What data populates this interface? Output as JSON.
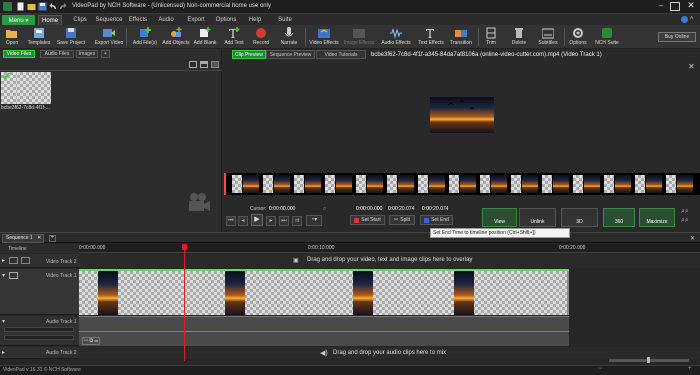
{
  "window": {
    "title": "VideoPad by NCH Software - (Unlicensed) Non-commercial home use only",
    "status": "VideoPad v 16.31 © NCH Software"
  },
  "menu": {
    "menu_label": "Menu ▾",
    "tabs": [
      "Home",
      "Clips",
      "Sequence",
      "Effects",
      "Audio",
      "Export",
      "Options",
      "Help",
      "Suite"
    ]
  },
  "ribbon": {
    "buttons": [
      "Open",
      "Templates",
      "Save Project",
      "Export Video",
      "Add File(s)",
      "Add Objects",
      "Add Blank",
      "Add Text",
      "Record",
      "Narrate",
      "Video Effects",
      "Image Effects",
      "Audio Effects",
      "Text Effects",
      "Transition",
      "Trim",
      "Delete",
      "Subtitles",
      "Options",
      "NCH Suite"
    ],
    "buy_label": "Buy Online"
  },
  "bin": {
    "tabs": [
      "Video Files",
      "Audio Files",
      "Images",
      "+"
    ],
    "clip_name": "bcbe3f62-7c8d-4f1f-..."
  },
  "preview": {
    "tabs": [
      "Clip Preview",
      "Sequence Preview",
      "Video Tutorials"
    ],
    "clip_title": "bcbe3f62-7c8d-4f1f-a345-84da7af8106a (online-video-cutter.com).mp4 (Video Track 1)",
    "cursor_label": "Cursor:",
    "cursor_time": "0:00:00.000",
    "range_start": "0:00:00.000",
    "range_mid": "0:00:20.074",
    "range_end": "0:00:20.074",
    "set_start": "Set Start",
    "split": "Split",
    "set_end": "Set End",
    "view": "View",
    "unlink": "Unlink",
    "three_d": "3D",
    "three_sixty": "360",
    "maximize": "Maximize",
    "tooltip": "Set End Time to timeline position (Ctrl+Shift+]) "
  },
  "timeline": {
    "sequence_tab": "Sequence 1",
    "ruler_label": "Timeline",
    "ruler_ticks": [
      "0:00:00.000",
      "0:00:10.000",
      "0:00:20.000"
    ],
    "tracks": {
      "video2": "Video Track 2",
      "video1": "Video Track 1",
      "audio1": "Audio Track 1",
      "audio2": "Audio Track 2"
    },
    "video_hint": "Drag and drop your video, text and image clips here to overlay",
    "audio_hint": "Drag and drop your audio clips here to mix"
  },
  "colors": {
    "accent_green": "#2e9a3e",
    "playhead_red": "#e02020"
  }
}
